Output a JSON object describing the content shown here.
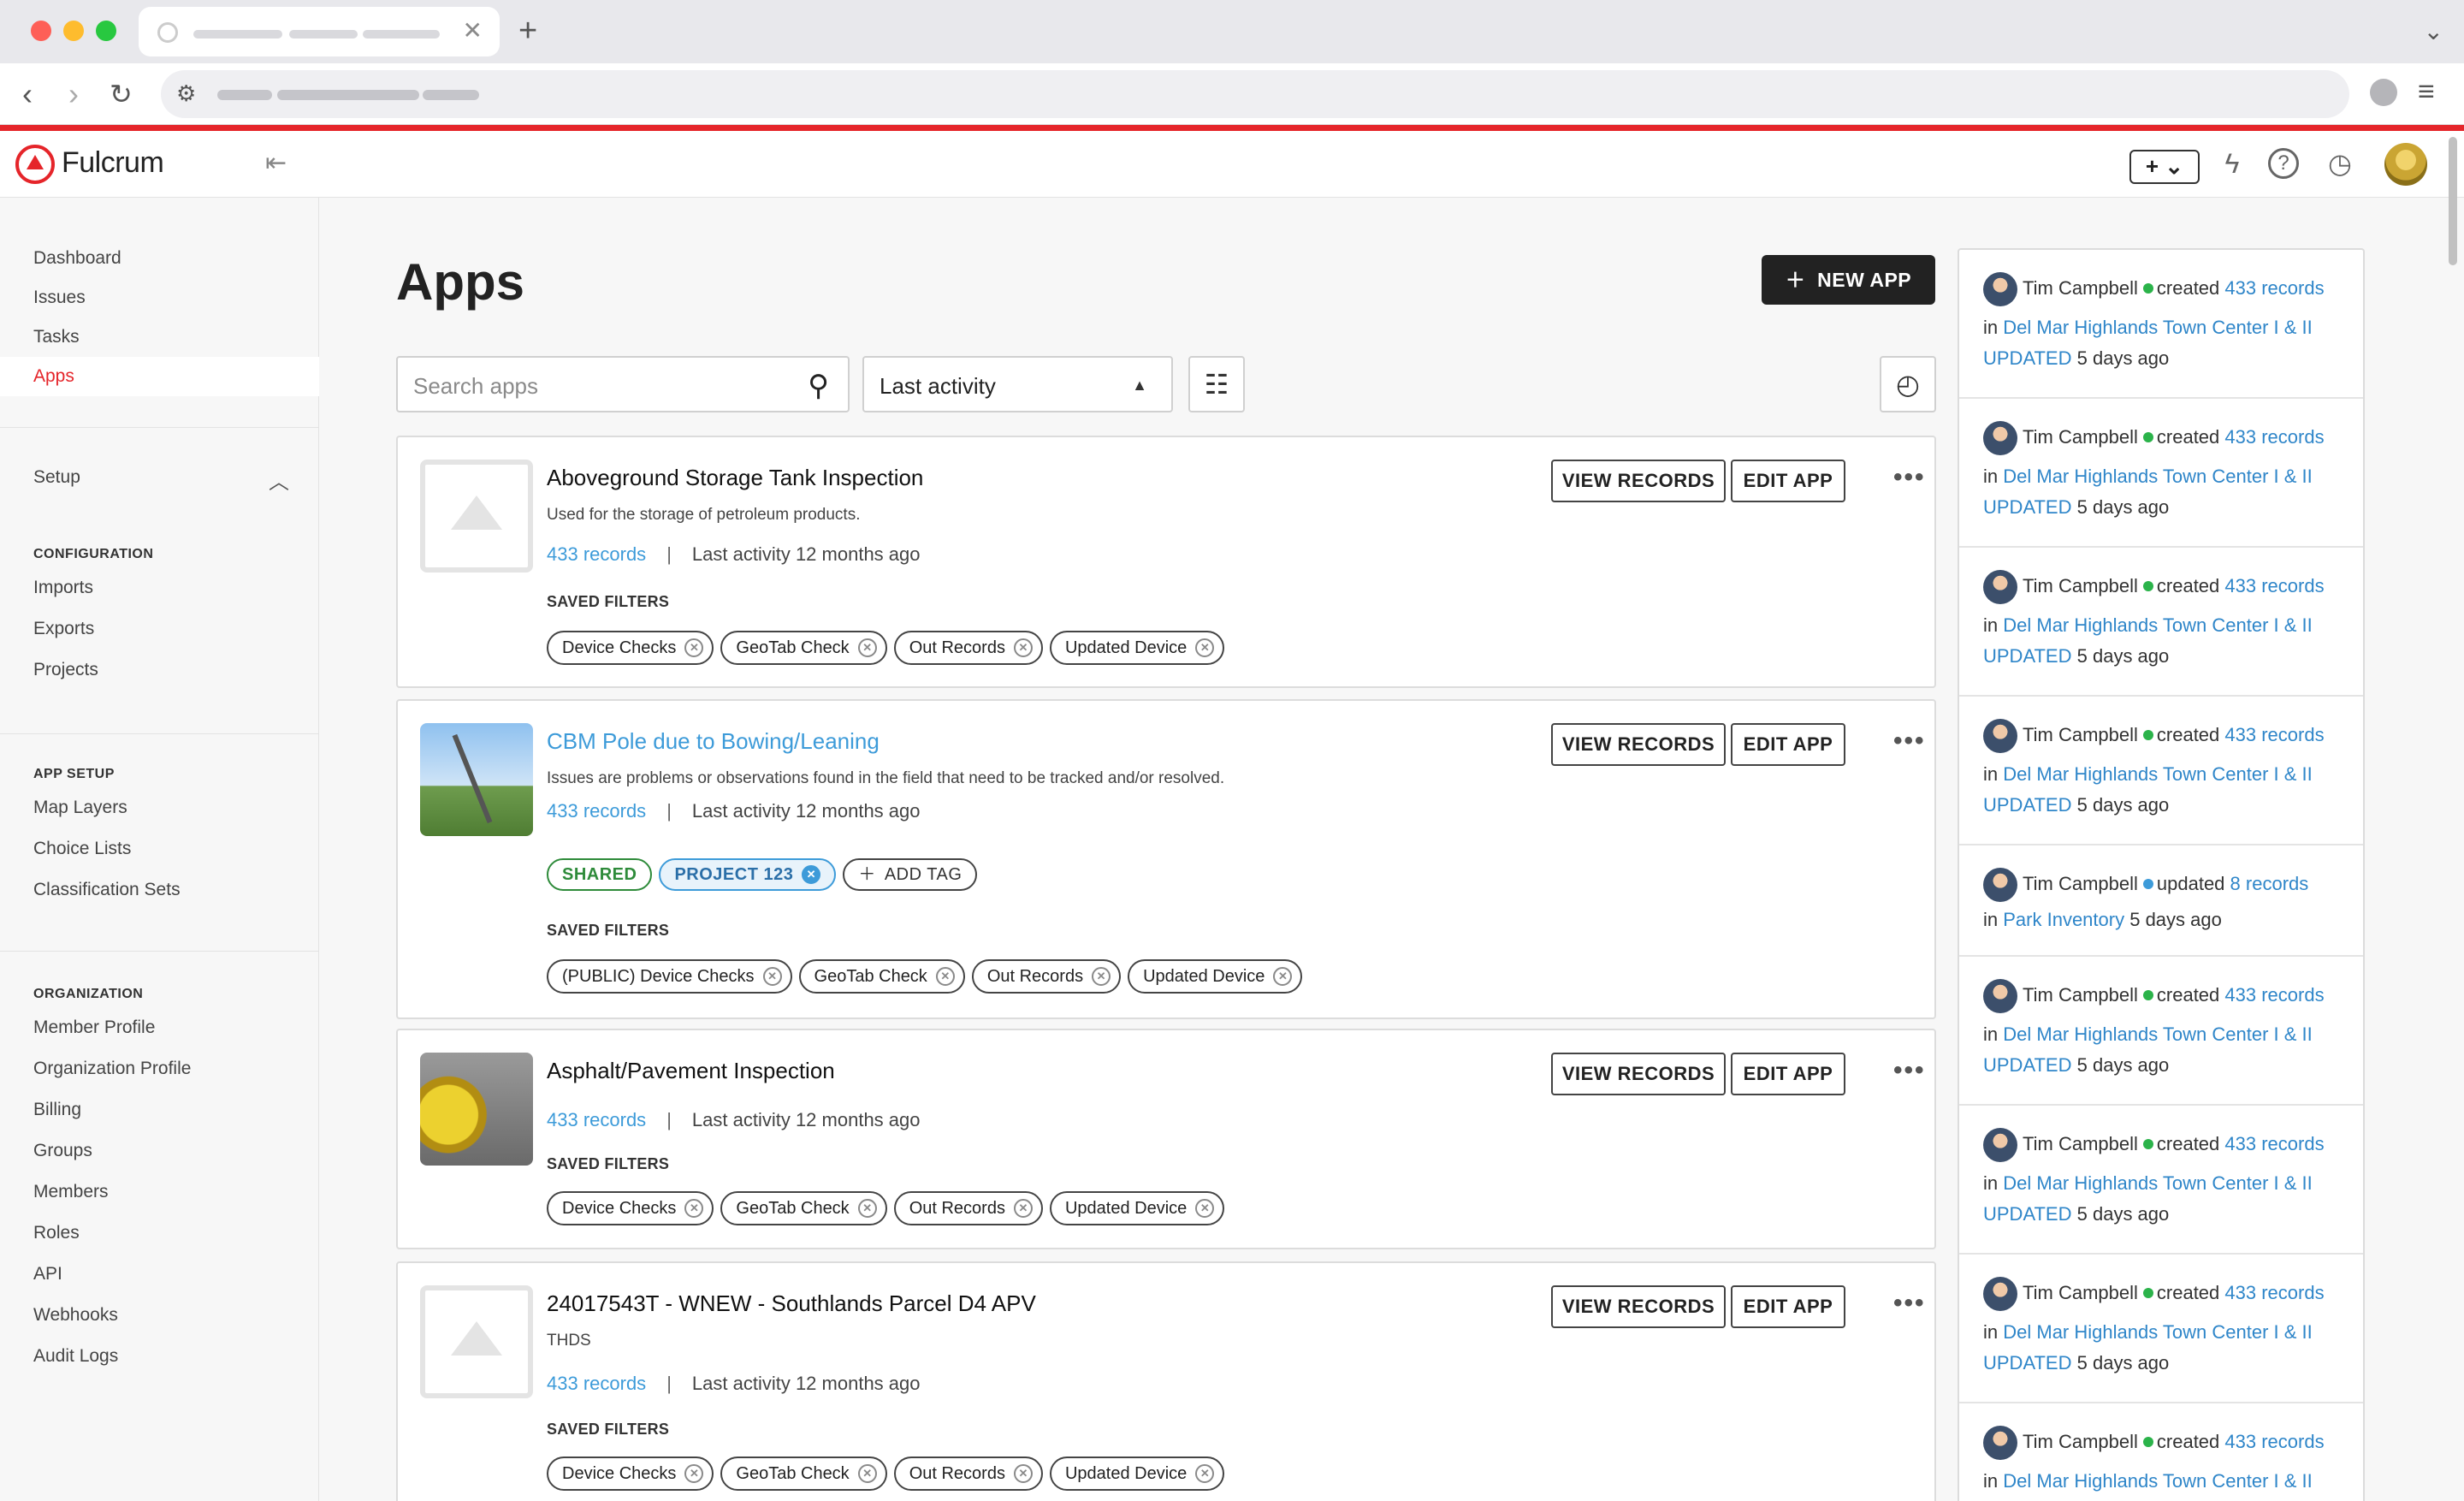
{
  "browser": {
    "tab_close": "✕",
    "new_tab": "+",
    "tab_menu": "⌄"
  },
  "brand": {
    "name": "Fulcrum"
  },
  "topbar": {
    "plus_label": "+ ⌄"
  },
  "sidebar": {
    "main_items": [
      {
        "label": "Dashboard"
      },
      {
        "label": "Issues"
      },
      {
        "label": "Tasks"
      },
      {
        "label": "Apps",
        "active": true
      }
    ],
    "setup_label": "Setup",
    "sections": [
      {
        "heading": "CONFIGURATION",
        "items": [
          "Imports",
          "Exports",
          "Projects"
        ]
      },
      {
        "heading": "APP SETUP",
        "items": [
          "Map Layers",
          "Choice Lists",
          "Classification Sets"
        ]
      },
      {
        "heading": "ORGANIZATION",
        "items": [
          "Member Profile",
          "Organization Profile",
          "Billing",
          "Groups",
          "Members",
          "Roles",
          "API",
          "Webhooks",
          "Audit Logs"
        ]
      }
    ]
  },
  "main": {
    "title": "Apps",
    "new_app_label": "NEW APP",
    "search_placeholder": "Search apps",
    "sort_value": "Last activity",
    "view_records_label": "VIEW RECORDS",
    "edit_app_label": "EDIT APP",
    "saved_filters_label": "SAVED FILTERS",
    "separator": "|",
    "apps": [
      {
        "name": "Aboveground Storage Tank Inspection",
        "description": "Used for the storage of petroleum products.",
        "records": "433 records",
        "activity": "Last activity 12 months ago",
        "filters": [
          "Device Checks",
          "GeoTab Check",
          "Out Records",
          "Updated Device"
        ]
      },
      {
        "name": "CBM Pole due to Bowing/Leaning",
        "description": "Issues are problems or observations found in the field that need to be tracked and/or resolved.",
        "records": "433 records",
        "activity": "Last activity 12 months ago",
        "tags": {
          "shared": "SHARED",
          "project": "PROJECT 123",
          "add": "ADD TAG"
        },
        "filters": [
          "(PUBLIC) Device Checks",
          "GeoTab Check",
          "Out Records",
          "Updated Device"
        ]
      },
      {
        "name": "Asphalt/Pavement Inspection",
        "description": "",
        "records": "433 records",
        "activity": "Last activity 12 months ago",
        "filters": [
          "Device Checks",
          "GeoTab Check",
          "Out Records",
          "Updated Device"
        ]
      },
      {
        "name": "24017543T - WNEW - Southlands Parcel D4 APV",
        "description": "THDS",
        "records": "433 records",
        "activity": "Last activity 12 months ago",
        "filters": [
          "Device Checks",
          "GeoTab Check",
          "Out Records",
          "Updated Device"
        ]
      }
    ]
  },
  "activity": [
    {
      "user": "Tim Campbell",
      "action": "created",
      "count": "433 records",
      "in": "in",
      "target": "Del Mar Highlands Town Center I & II",
      "tag": "UPDATED",
      "time": "5 days ago"
    },
    {
      "user": "Tim Campbell",
      "action": "created",
      "count": "433 records",
      "in": "in",
      "target": "Del Mar Highlands Town Center I & II",
      "tag": "UPDATED",
      "time": "5 days ago"
    },
    {
      "user": "Tim Campbell",
      "action": "created",
      "count": "433 records",
      "in": "in",
      "target": "Del Mar Highlands Town Center I & II",
      "tag": "UPDATED",
      "time": "5 days ago"
    },
    {
      "user": "Tim Campbell",
      "action": "created",
      "count": "433 records",
      "in": "in",
      "target": "Del Mar Highlands Town Center I & II",
      "tag": "UPDATED",
      "time": "5 days ago"
    },
    {
      "user": "Tim Campbell",
      "action": "updated",
      "count": "8 records",
      "in": "in",
      "target": "Park Inventory",
      "time": "5 days ago"
    },
    {
      "user": "Tim Campbell",
      "action": "created",
      "count": "433 records",
      "in": "in",
      "target": "Del Mar Highlands Town Center I & II",
      "tag": "UPDATED",
      "time": "5 days ago"
    },
    {
      "user": "Tim Campbell",
      "action": "created",
      "count": "433 records",
      "in": "in",
      "target": "Del Mar Highlands Town Center I & II",
      "tag": "UPDATED",
      "time": "5 days ago"
    },
    {
      "user": "Tim Campbell",
      "action": "created",
      "count": "433 records",
      "in": "in",
      "target": "Del Mar Highlands Town Center I & II",
      "tag": "UPDATED",
      "time": "5 days ago"
    },
    {
      "user": "Tim Campbell",
      "action": "created",
      "count": "433 records",
      "in": "in",
      "target": "Del Mar Highlands Town Center I & II"
    }
  ],
  "colors": {
    "accent": "#e5252a",
    "link": "#3d9bd9",
    "shared_tag": "#2e8b3a",
    "status_green": "#2bb34a",
    "status_blue": "#3d9bd9"
  }
}
